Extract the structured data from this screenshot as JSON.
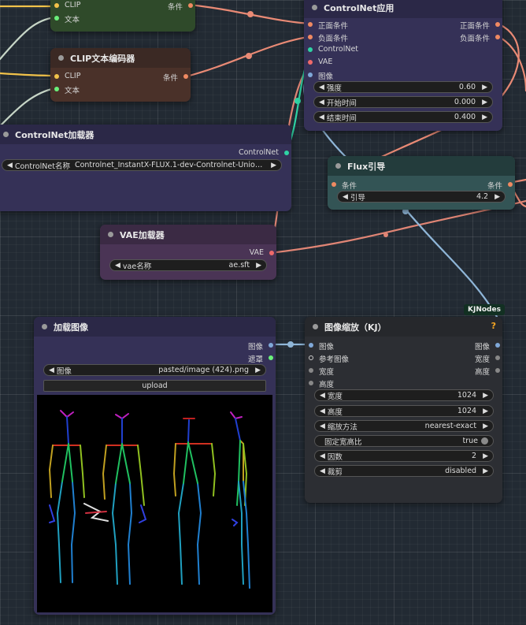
{
  "colors": {
    "clip": "#f1c24a",
    "conditioning": "#f08a62",
    "text": "#6af07a",
    "controlnet": "#2fd3a4",
    "vae": "#f06a6a",
    "image": "#7fa8d8"
  },
  "clip_top": {
    "in_clip": "CLIP",
    "in_text": "文本",
    "out_cond": "条件"
  },
  "clip_encoder": {
    "title": "CLIP文本编码器",
    "in_clip": "CLIP",
    "in_text": "文本",
    "out_cond": "条件"
  },
  "controlnet_apply": {
    "title": "ControlNet应用",
    "inputs": [
      "正面条件",
      "负面条件",
      "ControlNet",
      "VAE",
      "图像"
    ],
    "outputs": [
      "正面条件",
      "负面条件"
    ],
    "widgets": [
      {
        "label": "强度",
        "value": "0.60"
      },
      {
        "label": "开始时间",
        "value": "0.000"
      },
      {
        "label": "结束时间",
        "value": "0.400"
      }
    ]
  },
  "controlnet_loader": {
    "title": "ControlNet加载器",
    "out": "ControlNet",
    "widget_label": "ControlNet名称",
    "widget_value": "Controlnet_InstantX-FLUX.1-dev-Controlnet-Union-Pro...."
  },
  "flux_guidance": {
    "title": "Flux引导",
    "in": "条件",
    "out": "条件",
    "widget_label": "引导",
    "widget_value": "4.2"
  },
  "vae_loader": {
    "title": "VAE加载器",
    "out": "VAE",
    "widget_label": "vae名称",
    "widget_value": "ae.sft"
  },
  "load_image": {
    "title": "加载图像",
    "out_image": "图像",
    "out_mask": "遮罩",
    "widget_label": "图像",
    "widget_value": "pasted/image (424).png",
    "upload_label": "upload"
  },
  "image_resize": {
    "title": "图像缩放（KJ）",
    "badge": "KJNodes",
    "help": "?",
    "inputs": [
      "图像",
      "参考图像",
      "宽度",
      "高度"
    ],
    "outputs": [
      "图像",
      "宽度",
      "高度"
    ],
    "widgets": [
      {
        "label": "宽度",
        "value": "1024"
      },
      {
        "label": "高度",
        "value": "1024"
      },
      {
        "label": "缩放方法",
        "value": "nearest-exact"
      },
      {
        "label": "固定宽高比",
        "value": "true"
      },
      {
        "label": "因数",
        "value": "2"
      },
      {
        "label": "裁剪",
        "value": "disabled"
      }
    ]
  }
}
